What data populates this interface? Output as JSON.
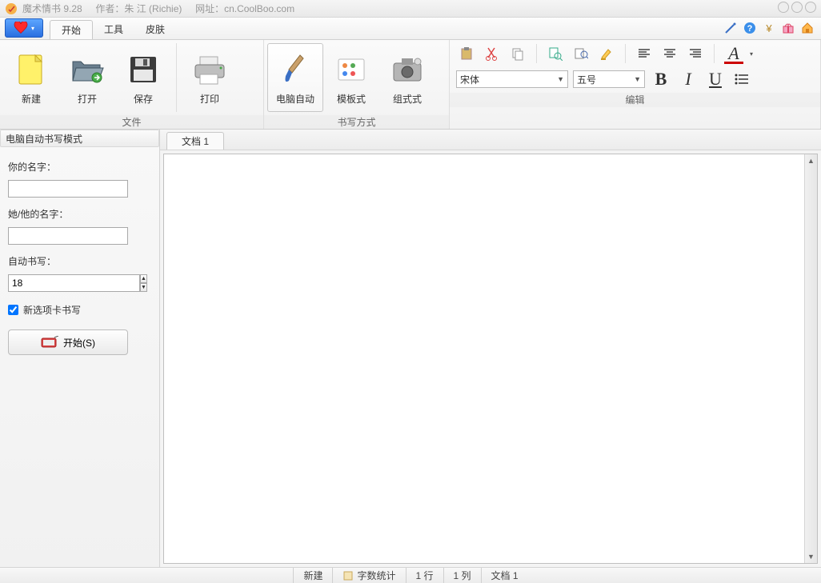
{
  "title": {
    "app": "魔术情书 9.28",
    "author_label": "作者：朱 江 (Richie)",
    "site_label": "网址：cn.CoolBoo.com"
  },
  "menu": {
    "tabs": [
      "开始",
      "工具",
      "皮肤"
    ],
    "active": 0
  },
  "ribbon": {
    "file_group": "文件",
    "write_group": "书写方式",
    "edit_group": "编辑",
    "btns": {
      "new": "新建",
      "open": "打开",
      "save": "保存",
      "print": "打印",
      "auto": "电脑自动",
      "template": "模板式",
      "combo": "组式式"
    },
    "font_name": "宋体",
    "font_size": "五号"
  },
  "sidebar": {
    "title": "电脑自动书写模式",
    "your_name": "你的名字：",
    "their_name": "她/他的名字：",
    "auto_write": "自动书写：",
    "spin_value": "18",
    "new_tab_write": "新选项卡书写",
    "start": "开始(S)"
  },
  "doc": {
    "tab": "文档 1"
  },
  "status": {
    "new": "新建",
    "wordcount": "字数统计",
    "line": "1 行",
    "col": "1 列",
    "doc": "文档 1"
  }
}
